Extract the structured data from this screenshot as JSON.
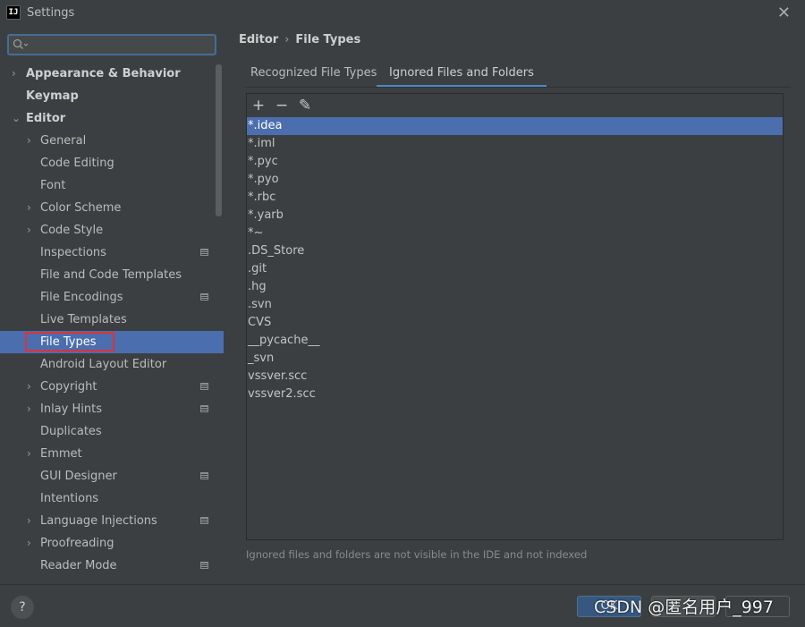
{
  "window": {
    "title": "Settings",
    "app_icon_text": "IJ"
  },
  "search": {
    "value": "",
    "placeholder": ""
  },
  "sidebar": {
    "items": [
      {
        "label": "Appearance & Behavior",
        "level": "top",
        "chevron": "›",
        "icon": ""
      },
      {
        "label": "Keymap",
        "level": "top",
        "chevron": "",
        "icon": ""
      },
      {
        "label": "Editor",
        "level": "top",
        "chevron": "⌄",
        "icon": ""
      },
      {
        "label": "General",
        "level": "sub",
        "chevron": "›",
        "icon": ""
      },
      {
        "label": "Code Editing",
        "level": "sub",
        "chevron": "",
        "icon": ""
      },
      {
        "label": "Font",
        "level": "sub",
        "chevron": "",
        "icon": ""
      },
      {
        "label": "Color Scheme",
        "level": "sub",
        "chevron": "›",
        "icon": ""
      },
      {
        "label": "Code Style",
        "level": "sub",
        "chevron": "›",
        "icon": ""
      },
      {
        "label": "Inspections",
        "level": "sub",
        "chevron": "",
        "icon": "project-settings-icon"
      },
      {
        "label": "File and Code Templates",
        "level": "sub",
        "chevron": "",
        "icon": ""
      },
      {
        "label": "File Encodings",
        "level": "sub",
        "chevron": "",
        "icon": "project-settings-icon"
      },
      {
        "label": "Live Templates",
        "level": "sub",
        "chevron": "",
        "icon": ""
      },
      {
        "label": "File Types",
        "level": "sub",
        "chevron": "",
        "icon": "",
        "selected": true
      },
      {
        "label": "Android Layout Editor",
        "level": "sub",
        "chevron": "",
        "icon": ""
      },
      {
        "label": "Copyright",
        "level": "sub",
        "chevron": "›",
        "icon": "project-settings-icon"
      },
      {
        "label": "Inlay Hints",
        "level": "sub",
        "chevron": "›",
        "icon": "project-settings-icon"
      },
      {
        "label": "Duplicates",
        "level": "sub",
        "chevron": "",
        "icon": ""
      },
      {
        "label": "Emmet",
        "level": "sub",
        "chevron": "›",
        "icon": ""
      },
      {
        "label": "GUI Designer",
        "level": "sub",
        "chevron": "",
        "icon": "project-settings-icon"
      },
      {
        "label": "Intentions",
        "level": "sub",
        "chevron": "",
        "icon": ""
      },
      {
        "label": "Language Injections",
        "level": "sub",
        "chevron": "›",
        "icon": "project-settings-icon"
      },
      {
        "label": "Proofreading",
        "level": "sub",
        "chevron": "›",
        "icon": ""
      },
      {
        "label": "Reader Mode",
        "level": "sub",
        "chevron": "",
        "icon": "project-settings-icon"
      }
    ]
  },
  "breadcrumb": {
    "parent": "Editor",
    "separator": "›",
    "current": "File Types"
  },
  "tabs": [
    {
      "label": "Recognized File Types",
      "active": false
    },
    {
      "label": "Ignored Files and Folders",
      "active": true
    }
  ],
  "toolbar": {
    "add": "+",
    "remove": "−",
    "edit": "✎"
  },
  "ignored_list": [
    "*.idea",
    "*.iml",
    "*.pyc",
    "*.pyo",
    "*.rbc",
    "*.yarb",
    "*~",
    ".DS_Store",
    ".git",
    ".hg",
    ".svn",
    "CVS",
    "__pycache__",
    "_svn",
    "vssver.scc",
    "vssver2.scc"
  ],
  "selected_row": 0,
  "hint": "Ignored files and folders are not visible in the IDE and not indexed",
  "footer": {
    "help": "?",
    "ok": "OK",
    "cancel": "",
    "apply": ""
  },
  "watermark": "CSDN @匿名用户_997",
  "colors": {
    "selection": "#4b6eaf",
    "accent": "#4a88c7",
    "highlight_border": "#e0303a"
  }
}
